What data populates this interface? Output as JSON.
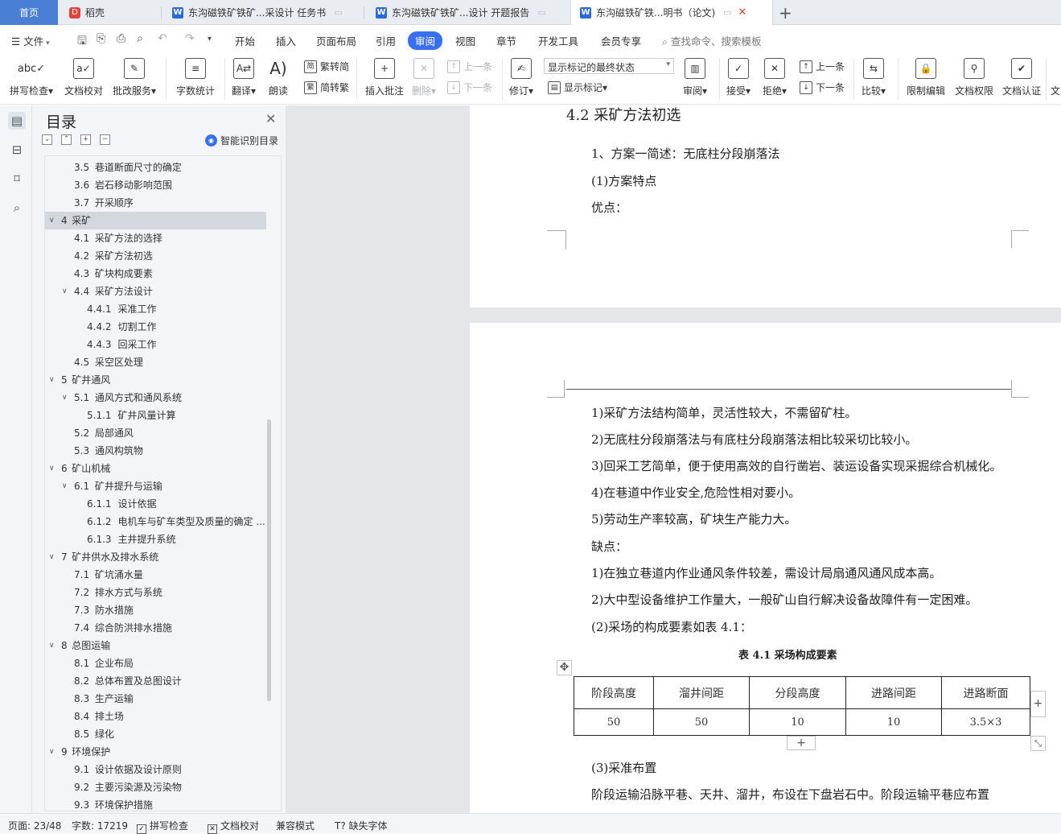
{
  "tabs": {
    "home": "首页",
    "daoke": "稻壳",
    "doc1": "东沟磁铁矿铁矿...采设计 任务书",
    "doc2": "东沟磁铁矿铁矿...设计 开题报告",
    "doc3": "东沟磁铁矿铁...明书（论文)",
    "new_tab": "+"
  },
  "menu": {
    "file": "文件",
    "items": [
      "开始",
      "插入",
      "页面布局",
      "引用",
      "审阅",
      "视图",
      "章节",
      "开发工具",
      "会员专享"
    ],
    "active": "审阅",
    "search": "查找命令、搜索模板"
  },
  "ribbon": {
    "spell": "拼写检查",
    "proof": "文档校对",
    "correct": "批改服务",
    "count": "字数统计",
    "translate": "翻译",
    "read": "朗读",
    "trad": "繁转简",
    "simp": "简转繁",
    "insert_comment": "插入批注",
    "delete": "删除",
    "prev_comment": "上一条",
    "next_comment": "下一条",
    "revise": "修订",
    "mark_state": "显示标记的最终状态",
    "show_marks": "显示标记",
    "review": "审阅",
    "accept": "接受",
    "reject": "拒绝",
    "prev": "上一条",
    "next": "下一条",
    "compare": "比较",
    "restrict": "限制编辑",
    "perm": "文档权限",
    "cert": "文档认证",
    "more": "文"
  },
  "nav": {
    "title": "目录",
    "smart": "智能识别目录",
    "items": [
      {
        "num": "3.5",
        "text": "巷道断面尺寸的确定",
        "level": 2
      },
      {
        "num": "3.6",
        "text": "岩石移动影响范围",
        "level": 2
      },
      {
        "num": "3.7",
        "text": "开采顺序",
        "level": 2
      },
      {
        "num": "4",
        "text": "采矿",
        "level": 1,
        "expanded": true,
        "selected": true
      },
      {
        "num": "4.1",
        "text": "采矿方法的选择",
        "level": 2
      },
      {
        "num": "4.2",
        "text": "采矿方法初选",
        "level": 2
      },
      {
        "num": "4.3",
        "text": "矿块构成要素",
        "level": 2
      },
      {
        "num": "4.4",
        "text": "采矿方法设计",
        "level": 2,
        "expanded": true
      },
      {
        "num": "4.4.1",
        "text": "采准工作",
        "level": 3
      },
      {
        "num": "4.4.2",
        "text": "切割工作",
        "level": 3
      },
      {
        "num": "4.4.3",
        "text": "回采工作",
        "level": 3
      },
      {
        "num": "4.5",
        "text": "采空区处理",
        "level": 2
      },
      {
        "num": "5",
        "text": "矿井通风",
        "level": 1,
        "expanded": true
      },
      {
        "num": "5.1",
        "text": "通风方式和通风系统",
        "level": 2,
        "expanded": true
      },
      {
        "num": "5.1.1",
        "text": "矿井风量计算",
        "level": 3
      },
      {
        "num": "5.2",
        "text": "局部通风",
        "level": 2
      },
      {
        "num": "5.3",
        "text": "通风构筑物",
        "level": 2
      },
      {
        "num": "6",
        "text": "矿山机械",
        "level": 1,
        "expanded": true
      },
      {
        "num": "6.1",
        "text": "矿井提升与运输",
        "level": 2,
        "expanded": true
      },
      {
        "num": "6.1.1",
        "text": "设计依据",
        "level": 3
      },
      {
        "num": "6.1.2",
        "text": "电机车与矿车类型及质量的确定 ...",
        "level": 3
      },
      {
        "num": "6.1.3",
        "text": "主井提升系统",
        "level": 3
      },
      {
        "num": "7",
        "text": "矿井供水及排水系统",
        "level": 1,
        "expanded": true
      },
      {
        "num": "7.1",
        "text": "矿坑涌水量",
        "level": 2
      },
      {
        "num": "7.2",
        "text": "排水方式与系统",
        "level": 2
      },
      {
        "num": "7.3",
        "text": "防水措施",
        "level": 2
      },
      {
        "num": "7.4",
        "text": "综合防洪排水措施",
        "level": 2
      },
      {
        "num": "8",
        "text": "总图运输",
        "level": 1,
        "expanded": true
      },
      {
        "num": "8.1",
        "text": "企业布局",
        "level": 2
      },
      {
        "num": "8.2",
        "text": "总体布置及总图设计",
        "level": 2
      },
      {
        "num": "8.3",
        "text": "生产运输",
        "level": 2
      },
      {
        "num": "8.4",
        "text": "排土场",
        "level": 2
      },
      {
        "num": "8.5",
        "text": "绿化",
        "level": 2
      },
      {
        "num": "9",
        "text": "环境保护",
        "level": 1,
        "expanded": true
      },
      {
        "num": "9.1",
        "text": "设计依据及设计原则",
        "level": 2
      },
      {
        "num": "9.2",
        "text": "主要污染源及污染物",
        "level": 2
      },
      {
        "num": "9.3",
        "text": "环境保护措施",
        "level": 2
      }
    ]
  },
  "document": {
    "heading": "4.2  采矿方法初选",
    "p1": "1、方案一简述：无底柱分段崩落法",
    "p2": "(1)方案特点",
    "p3": "优点：",
    "advantages": [
      "1)采矿方法结构简单，灵活性较大，不需留矿柱。",
      "2)无底柱分段崩落法与有底柱分段崩落法相比较采切比较小。",
      "3)回采工艺简单，便于使用高效的自行凿岩、装运设备实现采掘综合机械化。",
      "4)在巷道中作业安全,危险性相对要小。",
      "5)劳动生产率较高，矿块生产能力大。"
    ],
    "disadv_label": "缺点：",
    "disadvantages": [
      "1)在独立巷道内作业通风条件较差，需设计局扇通风通风成本高。",
      "2)大中型设备维护工作量大，一般矿山自行解决设备故障件有一定困难。"
    ],
    "p_table_ref": "(2)采场的构成要素如表 4.1：",
    "table_caption": "表 4.1  采场构成要素",
    "table_headers": [
      "阶段高度",
      "溜井间距",
      "分段高度",
      "进路间距",
      "进路断面"
    ],
    "table_values": [
      "50",
      "50",
      "10",
      "10",
      "3.5×3"
    ],
    "p_layout": "(3)采准布置",
    "p_last": "阶段运输沿脉平巷、天井、溜井，布设在下盘岩石中。阶段运输平巷应布置"
  },
  "status": {
    "page": "页面: 23/48",
    "words": "字数: 17219",
    "spell": "拼写检查",
    "proof": "文档校对",
    "compat": "兼容模式",
    "font": "缺失字体"
  }
}
